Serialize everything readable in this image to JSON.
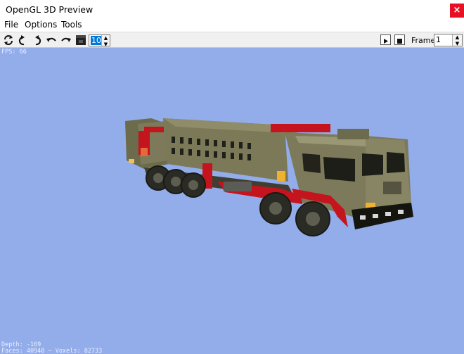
{
  "window": {
    "title": "OpenGL 3D Preview",
    "close_label": "×"
  },
  "menu": {
    "items": [
      "File",
      "Options",
      "Tools"
    ]
  },
  "toolbar": {
    "icons": [
      "refresh-icon",
      "rotate-left-icon",
      "rotate-right-icon",
      "undo-icon",
      "redo-icon",
      "background-color-icon"
    ],
    "size_value": "10",
    "play_icon": "play-icon",
    "stop_icon": "stop-icon",
    "frame_label": "Frame:",
    "frame_value": "1"
  },
  "hud": {
    "fps": "FPS: 66",
    "depth": "Depth: -169",
    "faces": "Faces: 40940 ~ Voxels: 82733"
  },
  "colors": {
    "viewport_bg": "#93acea",
    "truck_body": "#7c7a5a",
    "truck_accent": "#c4141e",
    "close_button": "#e81123"
  }
}
